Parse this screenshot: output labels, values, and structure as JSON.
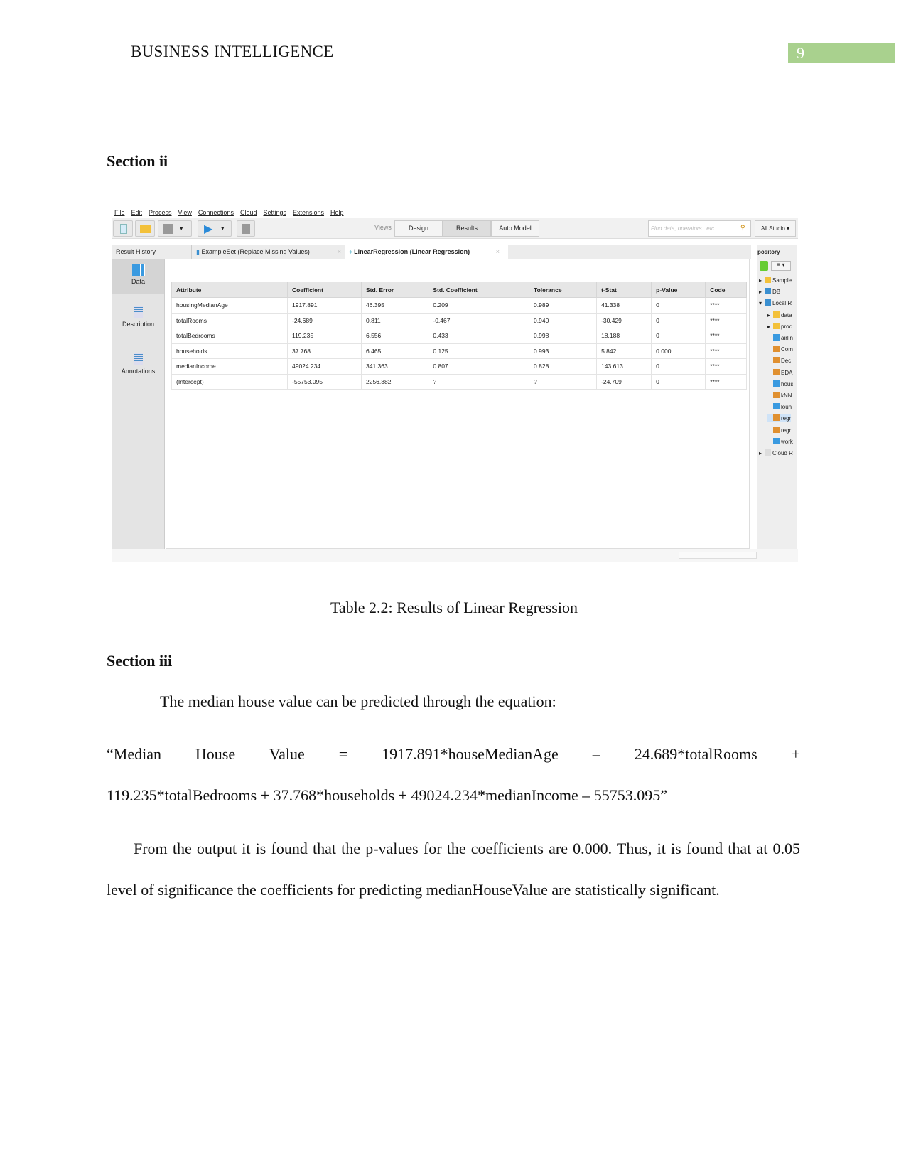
{
  "header": {
    "running_title": "BUSINESS INTELLIGENCE",
    "page_number": "9",
    "accent_color": "#a9d18e"
  },
  "section_ii": {
    "heading": "Section ii"
  },
  "app": {
    "menu": [
      "File",
      "Edit",
      "Process",
      "View",
      "Connections",
      "Cloud",
      "Settings",
      "Extensions",
      "Help"
    ],
    "views_label": "Views",
    "views": [
      "Design",
      "Results",
      "Auto Model"
    ],
    "active_view": "Results",
    "search_placeholder": "Find data, operators...etc",
    "studio_dropdown": "All Studio",
    "tabs": {
      "history": "Result History",
      "example_set": "ExampleSet (Replace Missing Values)",
      "linreg": "LinearRegression (Linear Regression)"
    },
    "left_panel": [
      "Data",
      "Description",
      "Annotations"
    ],
    "table": {
      "columns": [
        "Attribute",
        "Coefficient",
        "Std. Error",
        "Std. Coefficient",
        "Tolerance",
        "t-Stat",
        "p-Value",
        "Code"
      ],
      "rows": [
        [
          "housingMedianAge",
          "1917.891",
          "46.395",
          "0.209",
          "0.989",
          "41.338",
          "0",
          "****"
        ],
        [
          "totalRooms",
          "-24.689",
          "0.811",
          "-0.467",
          "0.940",
          "-30.429",
          "0",
          "****"
        ],
        [
          "totalBedrooms",
          "119.235",
          "6.556",
          "0.433",
          "0.998",
          "18.188",
          "0",
          "****"
        ],
        [
          "households",
          "37.768",
          "6.465",
          "0.125",
          "0.993",
          "5.842",
          "0.000",
          "****"
        ],
        [
          "medianIncome",
          "49024.234",
          "341.363",
          "0.807",
          "0.828",
          "143.613",
          "0",
          "****"
        ],
        [
          "(Intercept)",
          "-55753.095",
          "2256.382",
          "?",
          "?",
          "-24.709",
          "0",
          "****"
        ]
      ]
    },
    "repository": {
      "title": "pository",
      "items": [
        "Sample",
        "DB",
        "Local R",
        "data",
        "proc",
        "airlin",
        "Com",
        "Dec",
        "EDA",
        "hous",
        "kNN",
        "loun",
        "regr",
        "regr",
        "work",
        "Cloud R"
      ]
    }
  },
  "caption": "Table 2.2: Results of Linear Regression",
  "section_iii": {
    "heading": "Section iii",
    "intro": "The median house value can be predicted through the equation:",
    "equation_line1": [
      "“Median",
      "House",
      "Value",
      "=",
      "1917.891*houseMedianAge",
      "–",
      "24.689*totalRooms",
      "+"
    ],
    "equation_line2": "119.235*totalBedrooms + 37.768*households + 49024.234*medianIncome – 55753.095”",
    "conclusion": "From the output it is found that the p-values for the coefficients are 0.000. Thus, it is found that at 0.05 level of significance the coefficients for predicting medianHouseValue are statistically significant."
  }
}
